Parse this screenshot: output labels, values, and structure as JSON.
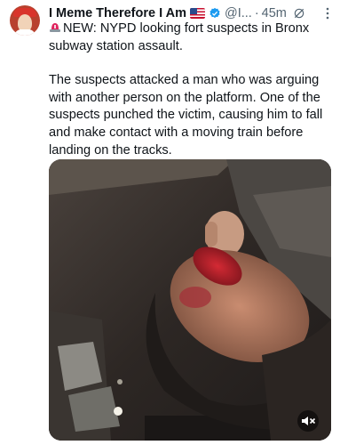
{
  "author": {
    "name": "I Meme Therefore I Am",
    "handle": "@I...",
    "separator": "·",
    "time": "45m"
  },
  "icons": {
    "flag": "us-flag-icon",
    "verified": "verified-badge-icon",
    "grok": "grok-icon",
    "more": "more-options-icon",
    "siren": "siren-icon",
    "mute": "mute-icon"
  },
  "tweet": {
    "line1": "NEW: NYPD looking fort suspects in Bronx subway station assault.",
    "line2": "The suspects attacked a man who was arguing with another person on the platform. One of the suspects punched the victim, causing him to fall and make contact with a moving train before landing on the tracks."
  },
  "colors": {
    "text": "#0f1419",
    "secondary": "#536471",
    "verified": "#1d9bf0",
    "siren": "#e0245e"
  }
}
